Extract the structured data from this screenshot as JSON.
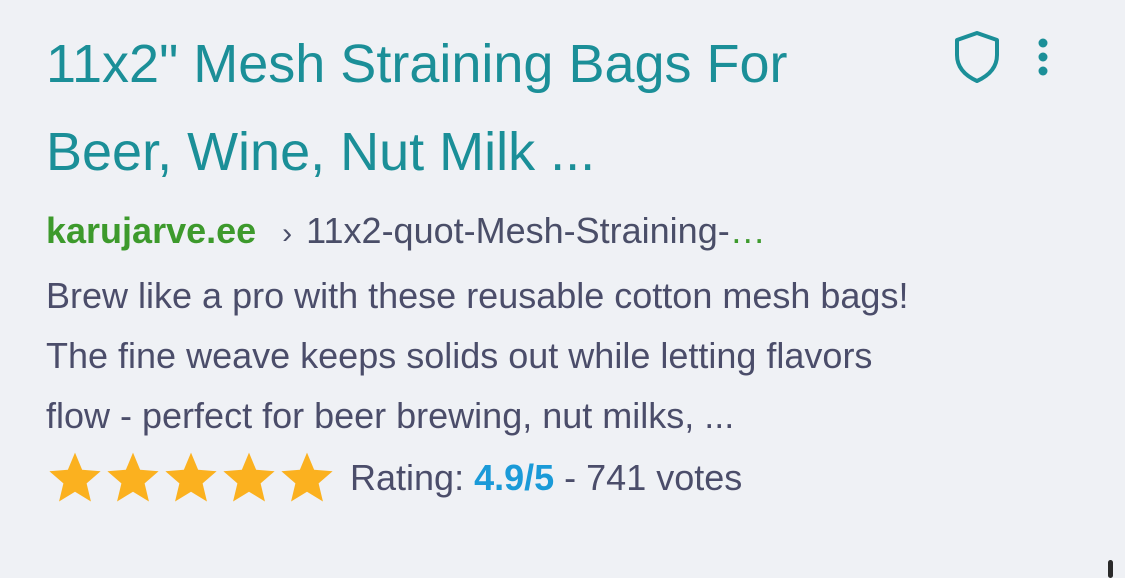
{
  "result": {
    "title_line1": "11x2\" Mesh Straining Bags For",
    "title_line2": "Beer, Wine, Nut Milk ...",
    "domain": "karujarve.ee",
    "breadcrumb_separator": "›",
    "path": "11x2-quot-Mesh-Straining-",
    "path_ellipsis": "…",
    "snippet_line1": "Brew like a pro with these reusable cotton mesh bags!",
    "snippet_line2": "The fine weave keeps solids out while letting flavors",
    "snippet_line3": "flow - perfect for beer brewing, nut milks, ...",
    "rating": {
      "label": "Rating: ",
      "value": "4.9/5",
      "separator": " - ",
      "votes": "741 votes",
      "stars_filled": 5,
      "stars_total": 5
    }
  },
  "icons": {
    "privacy": "shield-icon",
    "menu": "more-vertical-icon",
    "star": "star-icon"
  },
  "colors": {
    "title": "#1b8f98",
    "domain": "#3d9a2c",
    "text": "#4b4d6a",
    "rating_value": "#1a9ad8",
    "star": "#fbb11f",
    "background": "#eff1f5"
  }
}
